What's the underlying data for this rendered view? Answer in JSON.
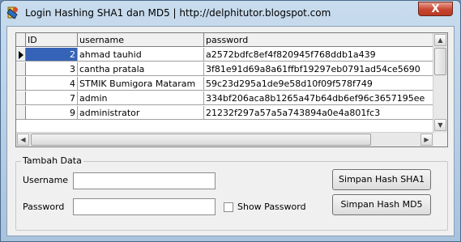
{
  "window": {
    "title": "Login Hashing SHA1 dan MD5 | http://delphitutor.blogspot.com",
    "close_glyph": "X"
  },
  "grid": {
    "columns": [
      "ID",
      "username",
      "password"
    ],
    "rows": [
      {
        "id": "2",
        "username": "ahmad tauhid",
        "password": "a2572bdfc8ef4f820945f768ddb1a439"
      },
      {
        "id": "3",
        "username": "cantha pratala",
        "password": "3f81e91d69a8a61ffbf19297eb0791ad54ce5690"
      },
      {
        "id": "4",
        "username": "STMIK Bumigora Mataram",
        "password": "59c23d295a1de9e58d10f09f578f749"
      },
      {
        "id": "7",
        "username": "admin",
        "password": "334bf206aca8b1265a47b64db6ef96c3657195ee"
      },
      {
        "id": "9",
        "username": "administrator",
        "password": "21232f297a57a5a743894a0e4a801fc3"
      }
    ]
  },
  "form": {
    "group_label": "Tambah Data",
    "username_label": "Username",
    "password_label": "Password",
    "show_password_label": "Show Password",
    "username_value": "",
    "password_value": "",
    "btn_sha1": "Simpan Hash SHA1",
    "btn_md5": "Simpan Hash MD5"
  }
}
